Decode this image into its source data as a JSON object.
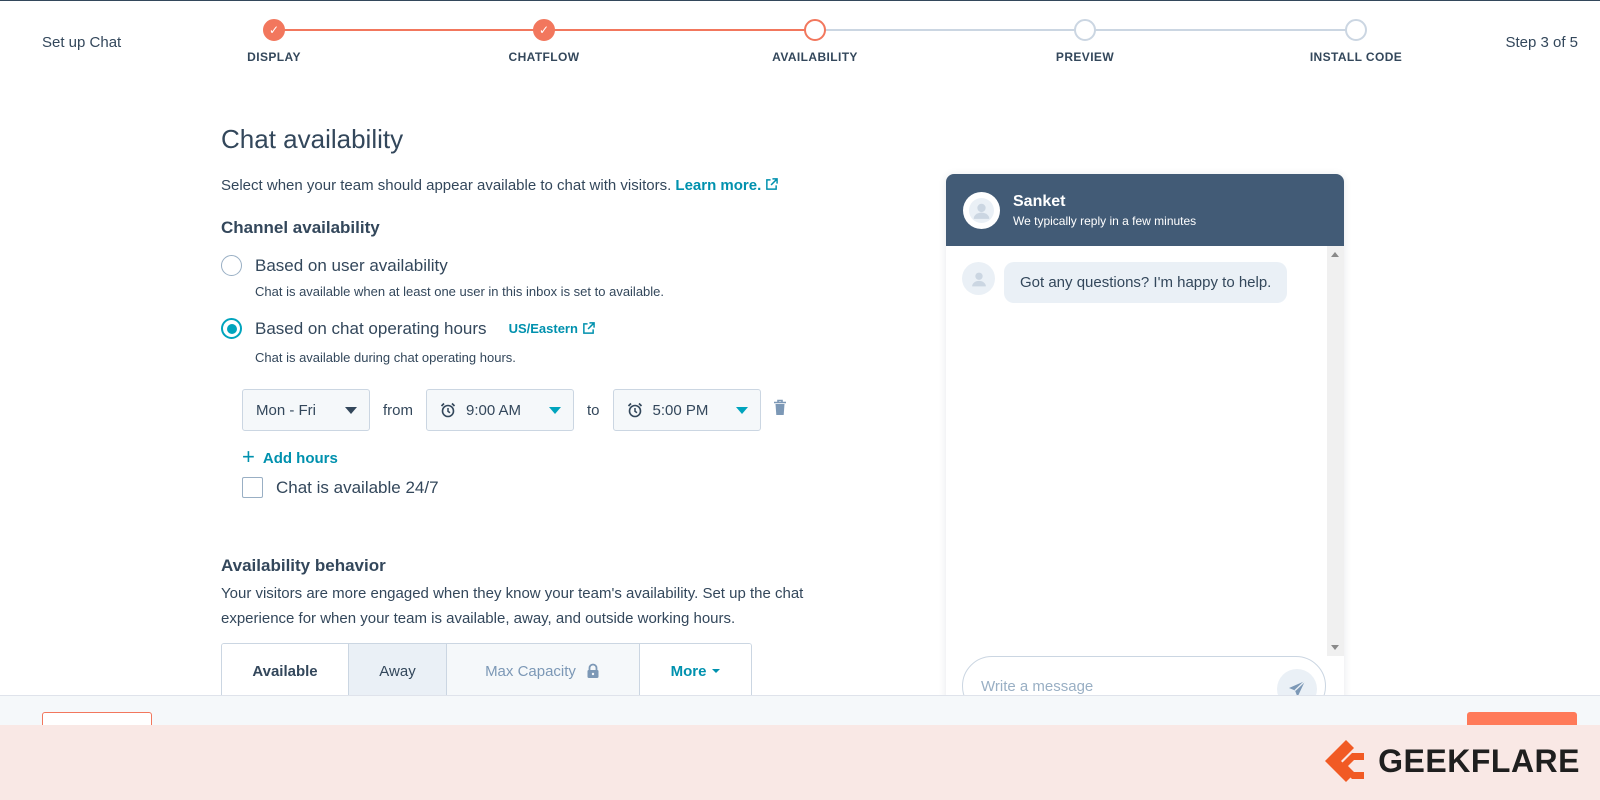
{
  "header": {
    "setup_label": "Set up Chat",
    "step_count": "Step 3 of 5",
    "steps": [
      {
        "label": "DISPLAY",
        "state": "done"
      },
      {
        "label": "CHATFLOW",
        "state": "done"
      },
      {
        "label": "AVAILABILITY",
        "state": "current"
      },
      {
        "label": "PREVIEW",
        "state": "todo"
      },
      {
        "label": "INSTALL CODE",
        "state": "todo"
      }
    ]
  },
  "main": {
    "title": "Chat availability",
    "intro": "Select when your team should appear available to chat with visitors.",
    "learn_more": "Learn more.",
    "channel_title": "Channel availability",
    "option_user": {
      "label": "Based on user availability",
      "help": "Chat is available when at least one user in this inbox is set to available.",
      "checked": false
    },
    "option_hours": {
      "label": "Based on chat operating hours",
      "timezone": "US/Eastern",
      "help": "Chat is available during chat operating hours.",
      "checked": true
    },
    "hours": {
      "days": "Mon - Fri",
      "from_label": "from",
      "start": "9:00 AM",
      "to_label": "to",
      "end": "5:00 PM"
    },
    "add_hours": "Add hours",
    "always_available": {
      "label": "Chat is available 24/7",
      "checked": false
    },
    "behavior_title": "Availability behavior",
    "behavior_desc": "Your visitors are more engaged when they know your team's availability. Set up the chat experience for when your team is available, away, and outside working hours.",
    "tabs": [
      "Available",
      "Away",
      "Max Capacity",
      "More"
    ]
  },
  "chat_preview": {
    "agent_name": "Sanket",
    "agent_status": "We typically reply in a few minutes",
    "message": "Got any questions? I'm happy to help.",
    "input_placeholder": "Write a message"
  },
  "brand": {
    "name": "GEEKFLARE"
  },
  "colors": {
    "accent": "#f2775d",
    "teal": "#00a4bd",
    "link": "#0091ae",
    "header_bg": "#425b76",
    "text": "#33475b"
  }
}
